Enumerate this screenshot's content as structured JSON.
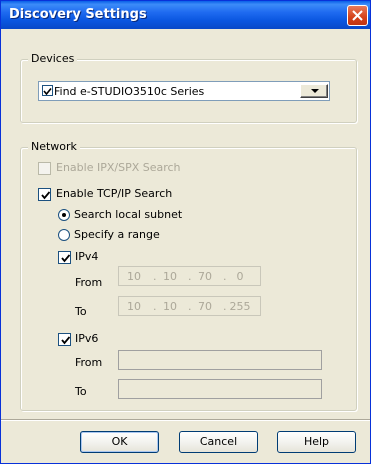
{
  "window": {
    "title": "Discovery Settings"
  },
  "devices": {
    "group_label": "Devices",
    "selected_option": "Find e-STUDIO3510c Series"
  },
  "network": {
    "group_label": "Network",
    "ipx_label": "Enable IPX/SPX Search",
    "tcpip_label": "Enable TCP/IP Search",
    "radio_local": "Search local subnet",
    "radio_range": "Specify a range",
    "ipv4": {
      "label": "IPv4",
      "from_label": "From",
      "to_label": "To",
      "from": [
        "10",
        "10",
        "70",
        "0"
      ],
      "to": [
        "10",
        "10",
        "70",
        "255"
      ]
    },
    "ipv6": {
      "label": "IPv6",
      "from_label": "From",
      "to_label": "To",
      "from": "",
      "to": ""
    }
  },
  "buttons": {
    "ok": "OK",
    "cancel": "Cancel",
    "help": "Help"
  }
}
